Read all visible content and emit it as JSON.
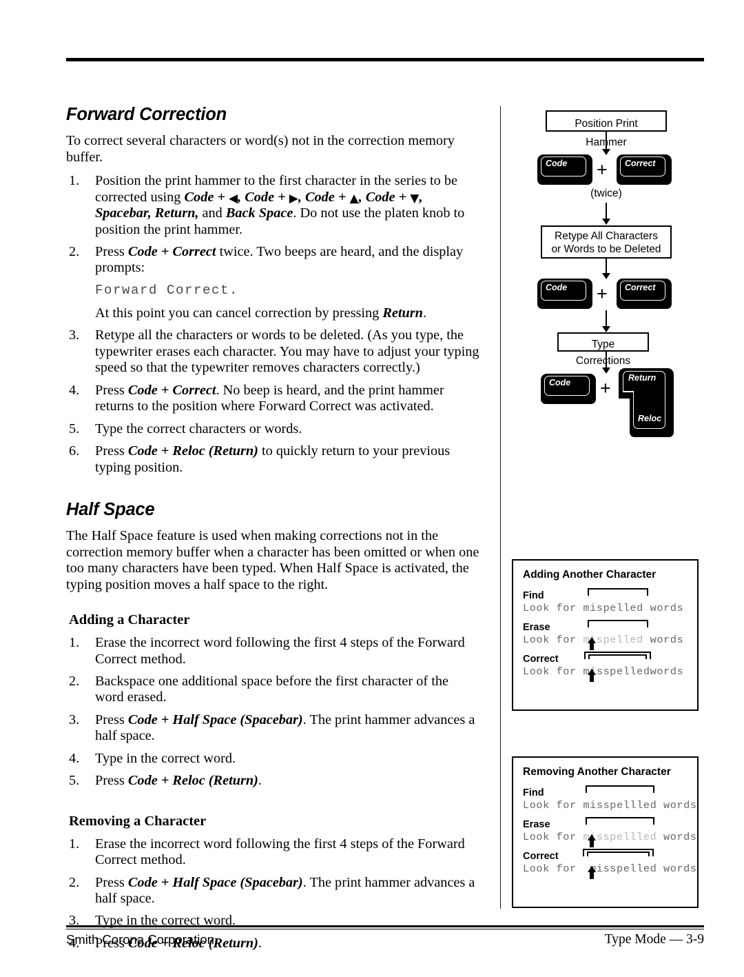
{
  "document": {
    "footer_left": "Smith Corona Corporation",
    "footer_right": "Type Mode — 3-9"
  },
  "forward_correction": {
    "heading": "Forward Correction",
    "intro": "To correct several characters or word(s) not in the correction memory buffer.",
    "step1_num": "1.",
    "step1_a": "Position the print hammer to the first character in the series to be corrected using ",
    "step1_keys_1": "Code + ",
    "step1_arrow_1": "◀",
    "step1_sep_1": ", ",
    "step1_keys_2": "Code + ",
    "step1_arrow_2": "▶",
    "step1_sep_2": ", ",
    "step1_keys_3": "Code + ",
    "step1_arrow_3": "▲",
    "step1_sep_3": ", ",
    "step1_keys_4": "Code + ",
    "step1_arrow_4": "▼",
    "step1_sep_4": ", ",
    "step1_keys_5": "Spacebar, Return,",
    "step1_b": " and ",
    "step1_keys_6": "Back Space",
    "step1_c": ". Do not use the platen knob to position the print hammer.",
    "step2_num": "2.",
    "step2_a": "Press ",
    "step2_key": "Code + Correct",
    "step2_b": " twice. Two beeps are heard, and the display prompts:",
    "lcd_prompt": "Forward Correct.",
    "cancel_a": "At this point you can cancel correction by pressing ",
    "cancel_key": "Return",
    "cancel_b": ".",
    "step3_num": "3.",
    "step3": "Retype all the characters or words to be deleted. (As you type, the typewriter erases each character. You may have to adjust your typing speed so that the typewriter removes characters correctly.)",
    "step4_num": "4.",
    "step4_a": "Press ",
    "step4_key": "Code + Correct",
    "step4_b": ". No beep is heard, and the print hammer returns to the position where Forward Correct was activated.",
    "step5_num": "5.",
    "step5": "Type the correct characters or words.",
    "step6_num": "6.",
    "step6_a": "Press ",
    "step6_key": "Code + Reloc (Return)",
    "step6_b": " to quickly return to your previous typing position."
  },
  "half_space": {
    "heading": "Half Space",
    "intro": "The Half Space feature is used when making corrections not in the correction memory buffer when a character has been omitted or when one too many characters have been typed. When Half Space is activated, the typing position moves a half space to the right.",
    "adding_heading": "Adding a Character",
    "add1_num": "1.",
    "add1": "Erase the incorrect word following the first 4 steps of the Forward Correct method.",
    "add2_num": "2.",
    "add2": "Backspace one additional space before the first character of the word erased.",
    "add3_num": "3.",
    "add3_a": "Press ",
    "add3_key": "Code + Half Space (Spacebar)",
    "add3_b": ". The print hammer advances a half space.",
    "add4_num": "4.",
    "add4": "Type in the correct word.",
    "add5_num": "5.",
    "add5_a": "Press ",
    "add5_key": "Code + Reloc (Return)",
    "add5_b": ".",
    "removing_heading": "Removing a Character",
    "rem1_num": "1.",
    "rem1": "Erase the incorrect word following the first 4 steps of the Forward Correct method.",
    "rem2_num": "2.",
    "rem2_a": "Press ",
    "rem2_key": "Code + Half Space (Spacebar)",
    "rem2_b": ". The print hammer advances a half space.",
    "rem3_num": "3.",
    "rem3": "Type in the correct word.",
    "rem4_num": "4.",
    "rem4_a": "Press ",
    "rem4_key": "Code + Reloc (Return)",
    "rem4_b": "."
  },
  "flowchart": {
    "box1": "Position Print Hammer",
    "key_code_1": "Code",
    "key_correct_1": "Correct",
    "plus_1": "+",
    "twice": "(twice)",
    "box2_line1": "Retype All Characters",
    "box2_line2": "or Words to be Deleted",
    "key_code_2": "Code",
    "key_correct_2": "Correct",
    "plus_2": "+",
    "box3": "Type Corrections",
    "key_code_3": "Code",
    "plus_3": "+",
    "key_return": "Return",
    "key_reloc": "Reloc"
  },
  "panel_add": {
    "title": "Adding Another Character",
    "find_label": "Find",
    "find_pre": "Look for ",
    "find_word": "mispelled",
    "find_post": " words",
    "erase_label": "Erase",
    "erase_pre": "Look for ",
    "erase_word": "mispelled",
    "erase_post": " words",
    "correct_label": "Correct",
    "correct_pre": "Look for ",
    "correct_word": "misspelled",
    "correct_post": "words"
  },
  "panel_remove": {
    "title": "Removing Another Character",
    "find_label": "Find",
    "find_pre": "Look for ",
    "find_word": "misspellled",
    "find_post": " words",
    "erase_label": "Erase",
    "erase_pre": "Look for ",
    "erase_word": "misspellled",
    "erase_post": " words",
    "correct_label": "Correct",
    "correct_pre": "Look for ",
    "correct_word": " misspelled",
    "correct_post": " words"
  }
}
